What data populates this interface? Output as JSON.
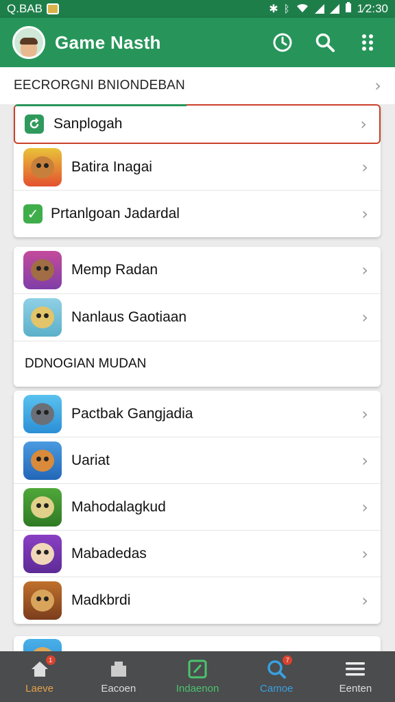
{
  "status_bar": {
    "left_text": "Q.BAB",
    "time": "1⁄2:30"
  },
  "app_bar": {
    "title": "Game Nasth"
  },
  "section1": {
    "header": "EECRORGNI BNIONDEBAN",
    "rows": [
      {
        "label": "Sanplogah"
      },
      {
        "label": "Batira Inagai"
      },
      {
        "label": "Prtanlgoan Jadardal"
      }
    ]
  },
  "section2": {
    "rows": [
      {
        "label": "Memp Radan"
      },
      {
        "label": "Nanlaus Gaotiaan"
      }
    ],
    "sub_header": "DDNOGIAN MUDAN"
  },
  "section3": {
    "rows": [
      {
        "label": "Pactbak Gangjadia"
      },
      {
        "label": "Uariat"
      },
      {
        "label": "Mahodalagkud"
      },
      {
        "label": "Mabadedas"
      },
      {
        "label": "Madkbrdi"
      }
    ]
  },
  "bottom_nav": [
    {
      "label": "Laeve",
      "icon": "home-icon",
      "color": "#e8a24a",
      "badge": "1"
    },
    {
      "label": "Eacoen",
      "icon": "store-icon",
      "color": "#dddddd",
      "badge": ""
    },
    {
      "label": "Indaenon",
      "icon": "edit-icon",
      "color": "#4cc46d",
      "badge": ""
    },
    {
      "label": "Camoe",
      "icon": "search-icon",
      "color": "#3aa0e0",
      "badge": "7"
    },
    {
      "label": "Eenten",
      "icon": "menu-icon",
      "color": "#eeeeee",
      "badge": ""
    }
  ],
  "colors": {
    "primary": "#27955a",
    "status_bar": "#1e7e4a",
    "highlight_border": "#c9402a",
    "nav_bg": "#4a4c4e"
  }
}
